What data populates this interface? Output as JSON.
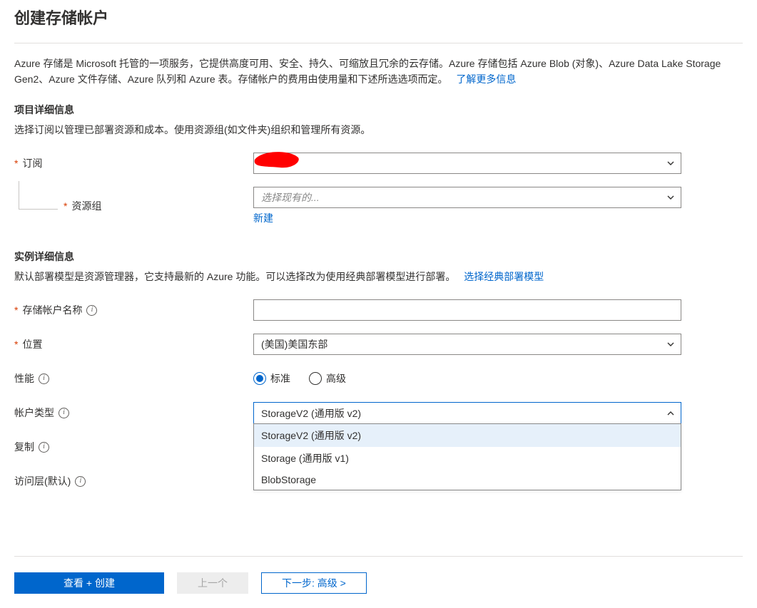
{
  "title": "创建存储帐户",
  "intro_text": "Azure 存储是 Microsoft 托管的一项服务，它提供高度可用、安全、持久、可缩放且冗余的云存储。Azure 存储包括 Azure Blob (对象)、Azure Data Lake Storage Gen2、Azure 文件存储、Azure 队列和 Azure 表。存储帐户的费用由使用量和下述所选选项而定。",
  "learn_more": "了解更多信息",
  "project": {
    "heading": "项目详细信息",
    "desc": "选择订阅以管理已部署资源和成本。使用资源组(如文件夹)组织和管理所有资源。",
    "subscription_label": "订阅",
    "subscription_value": "",
    "resource_group_label": "资源组",
    "resource_group_placeholder": "选择现有的...",
    "new_link": "新建"
  },
  "instance": {
    "heading": "实例详细信息",
    "desc": "默认部署模型是资源管理器，它支持最新的 Azure 功能。可以选择改为使用经典部署模型进行部署。",
    "classic_link": "选择经典部署模型",
    "name_label": "存储帐户名称",
    "location_label": "位置",
    "location_value": "(美国)美国东部",
    "performance_label": "性能",
    "perf_standard": "标准",
    "perf_premium": "高级",
    "kind_label": "帐户类型",
    "kind_value": "StorageV2 (通用版 v2)",
    "kind_options": [
      "StorageV2 (通用版 v2)",
      "Storage (通用版 v1)",
      "BlobStorage"
    ],
    "replication_label": "复制",
    "tier_label": "访问层(默认)"
  },
  "footer": {
    "review": "查看 + 创建",
    "prev": "上一个",
    "next": "下一步: 高级 >"
  }
}
